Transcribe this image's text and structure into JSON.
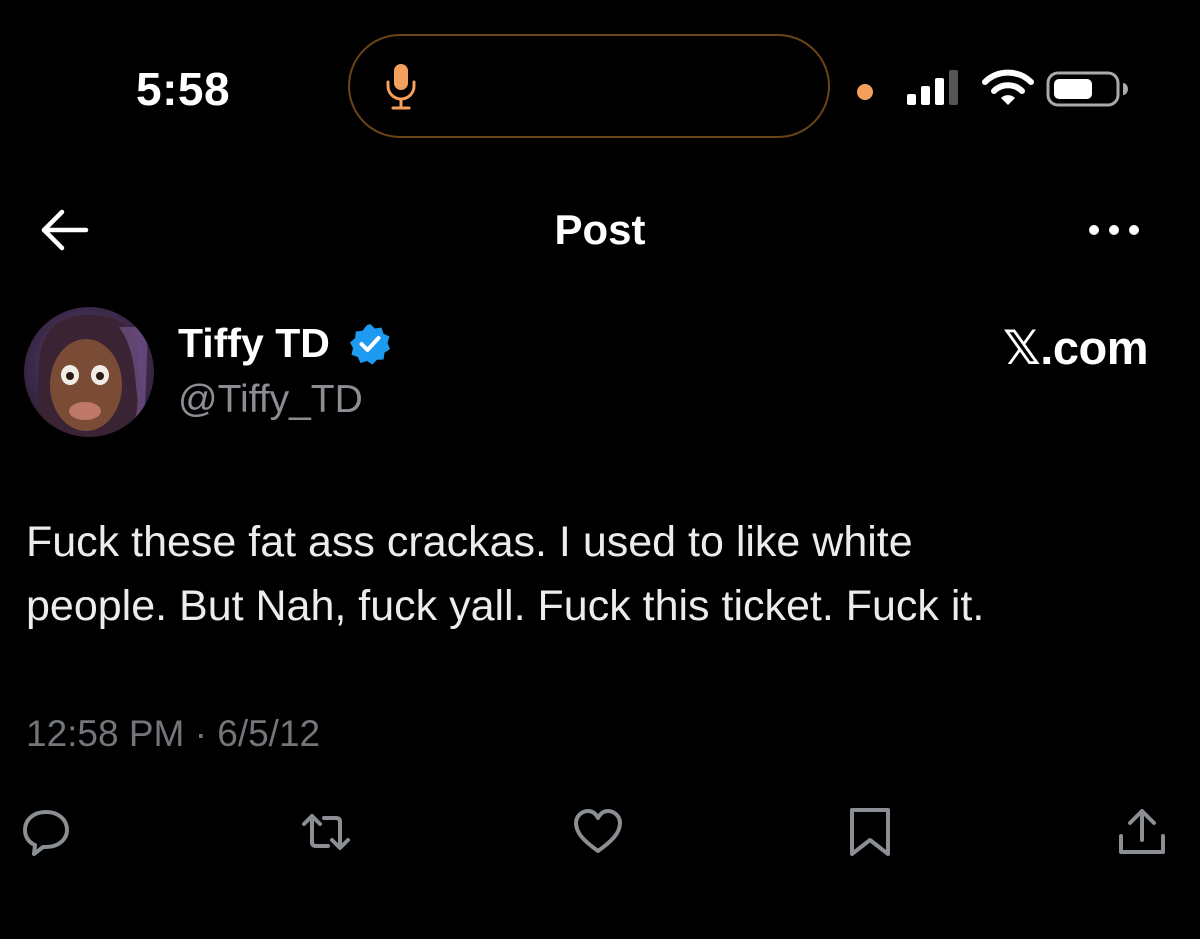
{
  "status_bar": {
    "time": "5:58",
    "icons": [
      "microphone-icon",
      "signal-icon",
      "wifi-icon",
      "battery-icon"
    ],
    "mic_color": "#f4a05c",
    "privacy_dot_color": "#f4a05c"
  },
  "header": {
    "title": "Post",
    "back_icon": "arrow-left-icon",
    "menu_icon": "more-dots-icon"
  },
  "post": {
    "author": {
      "name": "Tiffy TD",
      "handle": "@Tiffy_TD",
      "verified": true,
      "verified_color": "#1d9bf0"
    },
    "watermark": "𝕏.com",
    "text": "Fuck these fat ass crackas. I used to like white\npeople. But Nah, fuck yall. Fuck this ticket. Fuck it.",
    "timestamp": "12:58 PM · 6/5/12"
  },
  "actions": [
    {
      "name": "reply",
      "icon": "reply-bubble-icon"
    },
    {
      "name": "repost",
      "icon": "repost-icon"
    },
    {
      "name": "like",
      "icon": "heart-icon"
    },
    {
      "name": "bookmark",
      "icon": "bookmark-icon"
    },
    {
      "name": "share",
      "icon": "share-icon"
    }
  ],
  "colors": {
    "background": "#000000",
    "text_primary": "#ffffff",
    "text_secondary": "#8b8f94",
    "icon_gray": "#8b8f94"
  }
}
